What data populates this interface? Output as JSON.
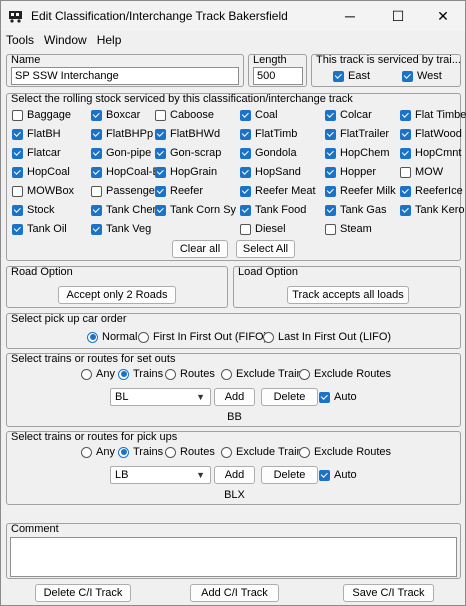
{
  "window": {
    "title": "Edit Classification/Interchange Track Bakersfield",
    "minimize": "─",
    "maximize": "☐",
    "close": "✕"
  },
  "menu": [
    "Tools",
    "Window",
    "Help"
  ],
  "name": {
    "label": "Name",
    "value": "SP SSW Interchange"
  },
  "length": {
    "label": "Length",
    "value": "500"
  },
  "service": {
    "label": "This track is serviced by trai...",
    "east": "East",
    "west": "West",
    "east_checked": true,
    "west_checked": true
  },
  "rolling_stock": {
    "label": "Select the rolling stock serviced by this classification/interchange track",
    "items": [
      {
        "label": "Baggage",
        "checked": false
      },
      {
        "label": "Boxcar",
        "checked": true
      },
      {
        "label": "Caboose",
        "checked": false
      },
      {
        "label": "Coal",
        "checked": true
      },
      {
        "label": "Colcar",
        "checked": true
      },
      {
        "label": "Flat Timber",
        "checked": true
      },
      {
        "label": "FlatBH",
        "checked": true
      },
      {
        "label": "FlatBHPp",
        "checked": true
      },
      {
        "label": "FlatBHWd",
        "checked": true
      },
      {
        "label": "FlatTimb",
        "checked": true
      },
      {
        "label": "FlatTrailer",
        "checked": true
      },
      {
        "label": "FlatWood",
        "checked": true
      },
      {
        "label": "Flatcar",
        "checked": true
      },
      {
        "label": "Gon-pipe",
        "checked": true
      },
      {
        "label": "Gon-scrap",
        "checked": true
      },
      {
        "label": "Gondola",
        "checked": true
      },
      {
        "label": "HopChem",
        "checked": true
      },
      {
        "label": "HopCmnt",
        "checked": true
      },
      {
        "label": "HopCoal",
        "checked": true
      },
      {
        "label": "HopCoal-E",
        "checked": true
      },
      {
        "label": "HopGrain",
        "checked": true
      },
      {
        "label": "HopSand",
        "checked": true
      },
      {
        "label": "Hopper",
        "checked": true
      },
      {
        "label": "MOW",
        "checked": false
      },
      {
        "label": "MOWBox",
        "checked": false
      },
      {
        "label": "Passenger",
        "checked": false
      },
      {
        "label": "Reefer",
        "checked": true
      },
      {
        "label": "Reefer Meat",
        "checked": true
      },
      {
        "label": "Reefer Milk",
        "checked": true
      },
      {
        "label": "ReeferIce",
        "checked": true
      },
      {
        "label": "Stock",
        "checked": true
      },
      {
        "label": "Tank Chem",
        "checked": true
      },
      {
        "label": "Tank Corn Sy",
        "checked": true
      },
      {
        "label": "Tank Food",
        "checked": true
      },
      {
        "label": "Tank Gas",
        "checked": true
      },
      {
        "label": "Tank Kero",
        "checked": true
      },
      {
        "label": "Tank Oil",
        "checked": true
      },
      {
        "label": "Tank Veg",
        "checked": true
      },
      {
        "label": "",
        "checked": false
      },
      {
        "label": "Diesel",
        "checked": false
      },
      {
        "label": "Steam",
        "checked": false
      },
      {
        "label": "",
        "checked": false
      }
    ],
    "clear_all": "Clear all",
    "select_all": "Select All"
  },
  "road_option": {
    "label": "Road Option",
    "button": "Accept only 2 Roads"
  },
  "load_option": {
    "label": "Load Option",
    "button": "Track accepts all loads"
  },
  "pickup_order": {
    "label": "Select pick up car order",
    "options": [
      "Normal",
      "First In First Out (FIFO)",
      "Last In First Out (LIFO)"
    ],
    "selected": 0
  },
  "setouts": {
    "label": "Select trains or routes for set outs",
    "options": [
      "Any",
      "Trains",
      "Routes",
      "Exclude Trains",
      "Exclude Routes"
    ],
    "selected": 1,
    "select_value": "BL",
    "add": "Add",
    "delete": "Delete",
    "auto": "Auto",
    "auto_checked": true,
    "list": "BB"
  },
  "pickups": {
    "label": "Select trains or routes for pick ups",
    "options": [
      "Any",
      "Trains",
      "Routes",
      "Exclude Trains",
      "Exclude Routes"
    ],
    "selected": 1,
    "select_value": "LB",
    "add": "Add",
    "delete": "Delete",
    "auto": "Auto",
    "auto_checked": true,
    "list": "BLX"
  },
  "comment": {
    "label": "Comment",
    "value": ""
  },
  "footer": {
    "delete": "Delete C/I Track",
    "add": "Add C/I Track",
    "save": "Save C/I Track"
  },
  "colors": {
    "accent": "#1a73c9",
    "background": "#f0f0f0"
  }
}
